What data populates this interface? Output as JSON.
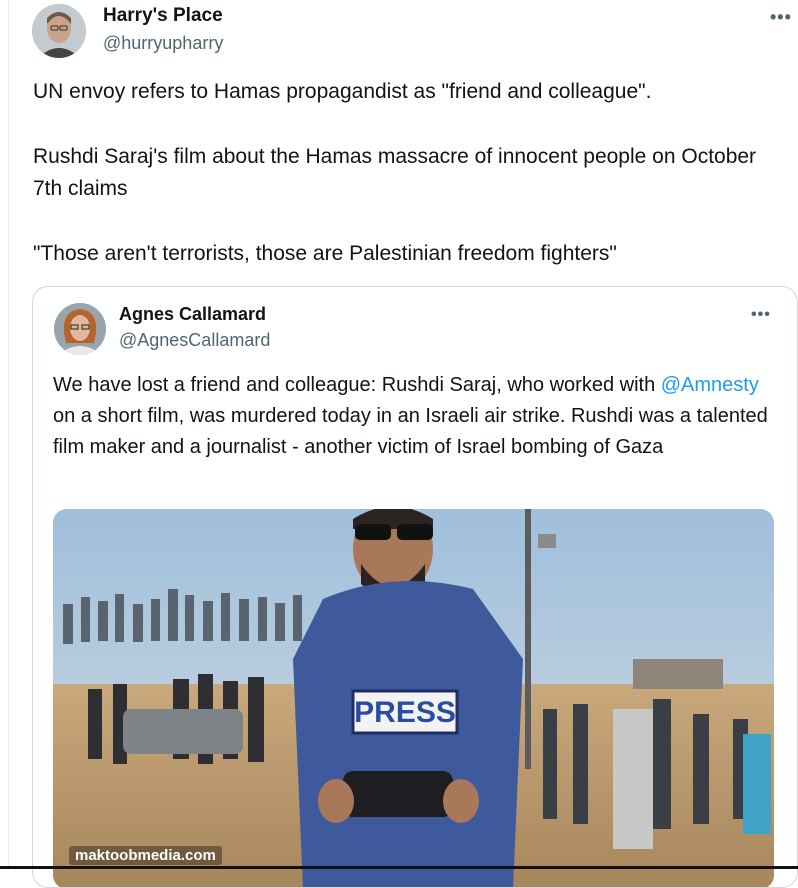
{
  "tweet": {
    "author_name": "Harry's Place",
    "author_handle": "@hurryupharry",
    "more_icon": "more-horizontal-icon",
    "paragraphs": [
      "UN envoy refers to Hamas  propagandist as \"friend and colleague\".",
      "Rushdi Saraj's film about the Hamas massacre of innocent people on October 7th claims",
      "\"Those aren't terrorists, those are Palestinian freedom fighters\""
    ]
  },
  "quoted": {
    "author_name": "Agnes Callamard",
    "author_handle": "@AgnesCallamard",
    "text_before": "We have lost a friend and colleague: Rushdi Saraj, who worked with ",
    "mention": "@Amnesty",
    "text_after": " on a short film, was murdered today in an Israeli air strike. Rushdi was a talented film maker and a journalist - another victim of Israel bombing of Gaza",
    "media": {
      "vest_label": "PRESS",
      "watermark": "maktoobmedia.com"
    }
  },
  "colors": {
    "text": "#0f1419",
    "secondary": "#536471",
    "link": "#1d9bf0",
    "border": "#cfd9de"
  }
}
